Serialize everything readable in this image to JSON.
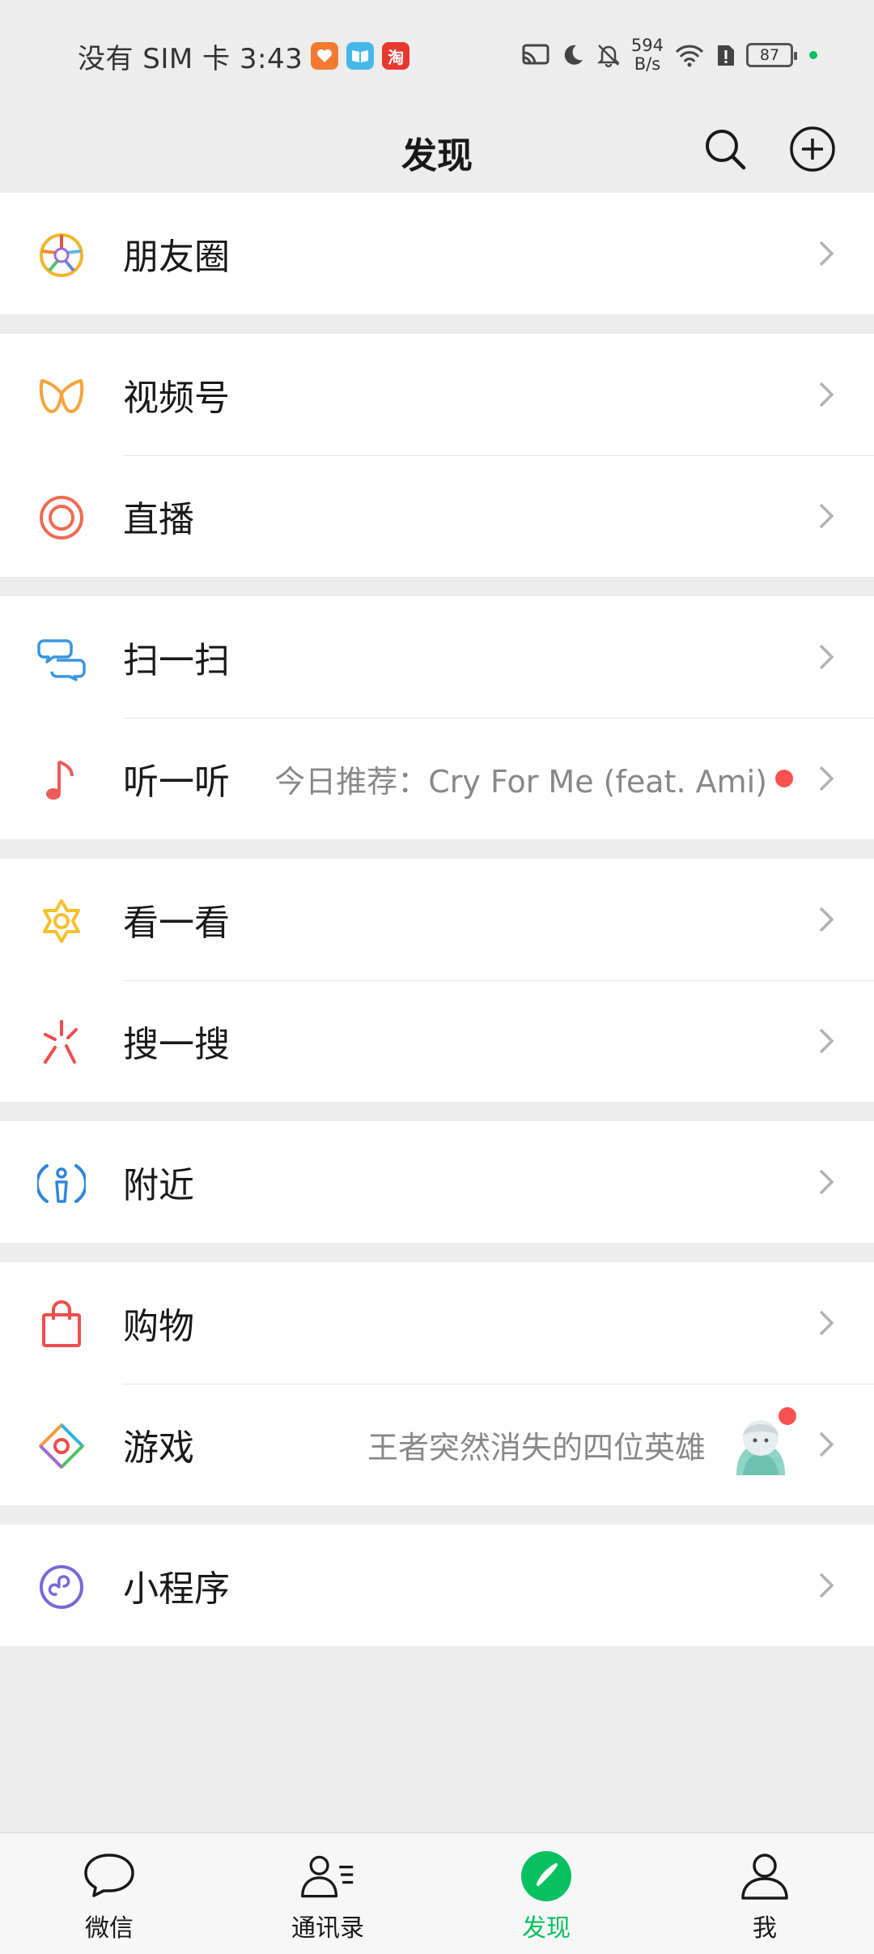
{
  "status_bar": {
    "carrier_time": "没有 SIM 卡 3:43",
    "app_badges": [
      "taobao-heart-icon",
      "book-icon",
      "taobao-icon"
    ],
    "taobao_label": "淘",
    "speed_value": "594",
    "speed_unit": "B/s",
    "battery": "87"
  },
  "nav": {
    "title": "发现"
  },
  "groups": [
    {
      "items": [
        {
          "label": "朋友圈",
          "icon": "moments-icon"
        }
      ]
    },
    {
      "items": [
        {
          "label": "视频号",
          "icon": "channels-icon"
        },
        {
          "label": "直播",
          "icon": "live-icon"
        }
      ]
    },
    {
      "items": [
        {
          "label": "扫一扫",
          "icon": "scan-icon"
        },
        {
          "label": "听一听",
          "icon": "music-note-icon",
          "extra": "今日推荐：Cry For Me (feat. Ami)"
        }
      ]
    },
    {
      "items": [
        {
          "label": "看一看",
          "icon": "top-stories-icon"
        },
        {
          "label": "搜一搜",
          "icon": "search-spark-icon"
        }
      ]
    },
    {
      "items": [
        {
          "label": "附近",
          "icon": "nearby-icon"
        }
      ]
    },
    {
      "items": [
        {
          "label": "购物",
          "icon": "shopping-bag-icon"
        },
        {
          "label": "游戏",
          "icon": "games-icon",
          "extra": "王者突然消失的四位英雄"
        }
      ]
    },
    {
      "items": [
        {
          "label": "小程序",
          "icon": "mini-programs-icon"
        }
      ]
    }
  ],
  "tabs": [
    {
      "label": "微信",
      "icon": "chat-bubble-icon",
      "active": false
    },
    {
      "label": "通讯录",
      "icon": "contacts-icon",
      "active": false
    },
    {
      "label": "发现",
      "icon": "discover-compass-icon",
      "active": true
    },
    {
      "label": "我",
      "icon": "me-icon",
      "active": false
    }
  ],
  "colors": {
    "accent": "#07c160",
    "background": "#ededed",
    "badge_red": "#fa5151"
  }
}
